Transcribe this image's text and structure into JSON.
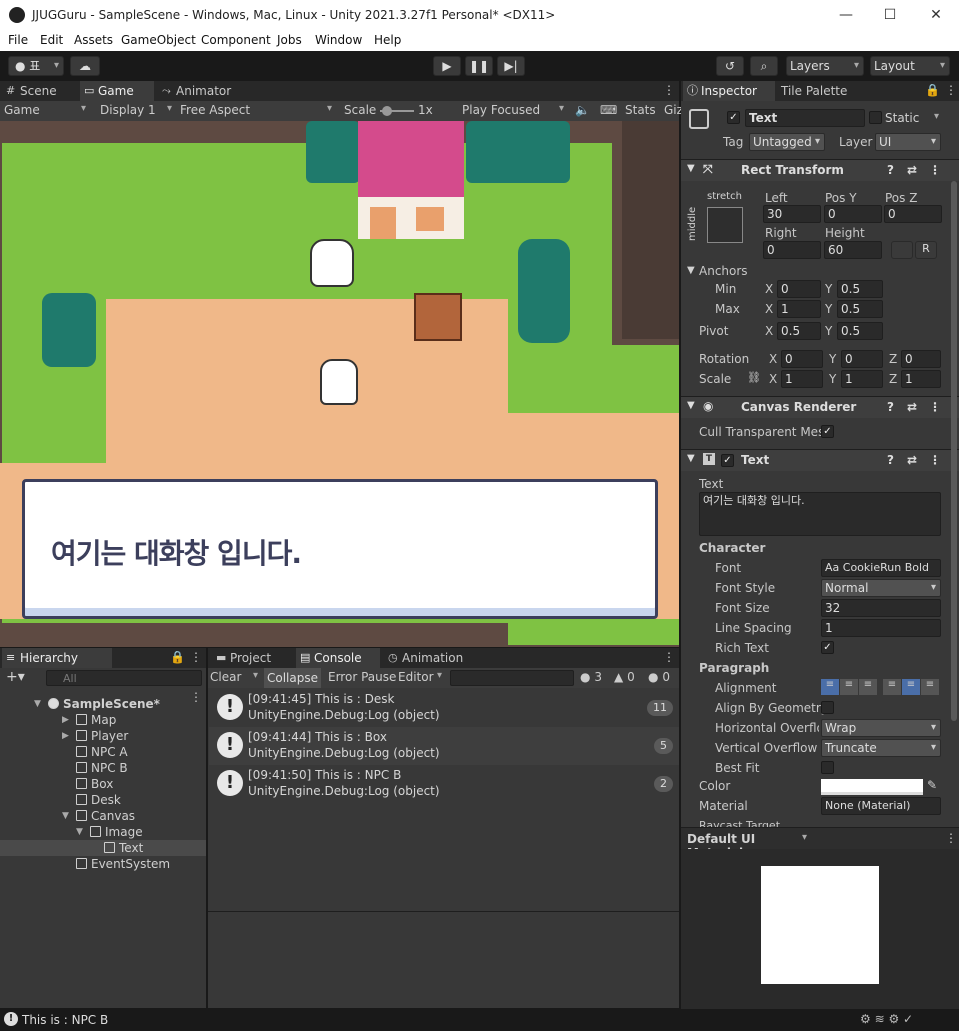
{
  "window": {
    "title": "JJUGGuru - SampleScene - Windows, Mac, Linux - Unity 2021.3.27f1 Personal* <DX11>",
    "minimize": "—",
    "maximize": "☐",
    "close": "✕"
  },
  "menu": [
    "File",
    "Edit",
    "Assets",
    "GameObject",
    "Component",
    "Jobs",
    "Window",
    "Help"
  ],
  "toolbar": {
    "account": "표",
    "layers": "Layers",
    "layout": "Layout"
  },
  "game_tabs": {
    "scene": "Scene",
    "game": "Game",
    "animator": "Animator"
  },
  "game_bar": {
    "mode": "Game",
    "display": "Display 1",
    "aspect": "Free Aspect",
    "scale_label": "Scale",
    "scale_value": "1x",
    "play_focused": "Play Focused",
    "stats": "Stats",
    "gizmos": "Giz"
  },
  "dialog": {
    "text": "여기는 대화창 입니다."
  },
  "hierarchy": {
    "tab": "Hierarchy",
    "search_placeholder": "All",
    "items": [
      {
        "label": "SampleScene*",
        "depth": 0
      },
      {
        "label": "Map",
        "depth": 1
      },
      {
        "label": "Player",
        "depth": 1
      },
      {
        "label": "NPC A",
        "depth": 1
      },
      {
        "label": "NPC B",
        "depth": 1
      },
      {
        "label": "Box",
        "depth": 1
      },
      {
        "label": "Desk",
        "depth": 1
      },
      {
        "label": "Canvas",
        "depth": 1
      },
      {
        "label": "Image",
        "depth": 2
      },
      {
        "label": "Text",
        "depth": 3
      },
      {
        "label": "EventSystem",
        "depth": 1
      }
    ]
  },
  "console": {
    "tabs": [
      "Project",
      "Console",
      "Animation"
    ],
    "clear": "Clear",
    "collapse": "Collapse",
    "error_pause": "Error Pause",
    "editor": "Editor",
    "count_log": "3",
    "count_warn": "0",
    "count_err": "0",
    "entries": [
      {
        "line1": "[09:41:45] This is : Desk",
        "line2": "UnityEngine.Debug:Log (object)",
        "count": "11"
      },
      {
        "line1": "[09:41:44] This is : Box",
        "line2": "UnityEngine.Debug:Log (object)",
        "count": "5"
      },
      {
        "line1": "[09:41:50] This is : NPC B",
        "line2": "UnityEngine.Debug:Log (object)",
        "count": "2"
      }
    ]
  },
  "status": {
    "text": "This is : NPC B"
  },
  "inspector": {
    "tab": "Inspector",
    "tab2": "Tile Palette",
    "name": "Text",
    "static": "Static",
    "tag_label": "Tag",
    "tag": "Untagged",
    "layer_label": "Layer",
    "layer": "UI",
    "rect": {
      "title": "Rect Transform",
      "stretch": "stretch",
      "middle": "middle",
      "left_l": "Left",
      "posy_l": "Pos Y",
      "posz_l": "Pos Z",
      "left": "30",
      "posy": "0",
      "posz": "0",
      "right_l": "Right",
      "height_l": "Height",
      "right": "0",
      "height": "60",
      "r_btn": "R",
      "anchors": "Anchors",
      "min": "Min",
      "max": "Max",
      "min_x": "0",
      "min_y": "0.5",
      "max_x": "1",
      "max_y": "0.5",
      "pivot": "Pivot",
      "pivot_x": "0.5",
      "pivot_y": "0.5",
      "rotation": "Rotation",
      "rot_x": "0",
      "rot_y": "0",
      "rot_z": "0",
      "scale": "Scale",
      "sc_x": "1",
      "sc_y": "1",
      "sc_z": "1"
    },
    "canvas_renderer": {
      "title": "Canvas Renderer",
      "cull": "Cull Transparent Mes"
    },
    "text": {
      "title": "Text",
      "text_label": "Text",
      "text_value": "여기는 대화창 입니다.",
      "character": "Character",
      "font_l": "Font",
      "font": "CookieRun Bold",
      "font_style_l": "Font Style",
      "font_style": "Normal",
      "font_size_l": "Font Size",
      "font_size": "32",
      "line_spacing_l": "Line Spacing",
      "line_spacing": "1",
      "rich_text_l": "Rich Text",
      "paragraph": "Paragraph",
      "alignment_l": "Alignment",
      "align_geo_l": "Align By Geometry",
      "h_overflow_l": "Horizontal Overflo",
      "h_overflow": "Wrap",
      "v_overflow_l": "Vertical Overflow",
      "v_overflow": "Truncate",
      "best_fit_l": "Best Fit",
      "color_l": "Color",
      "material_l": "Material",
      "material": "None (Material)",
      "raycast_l": "Raycast Target"
    },
    "default_material": "Default UI Material"
  }
}
